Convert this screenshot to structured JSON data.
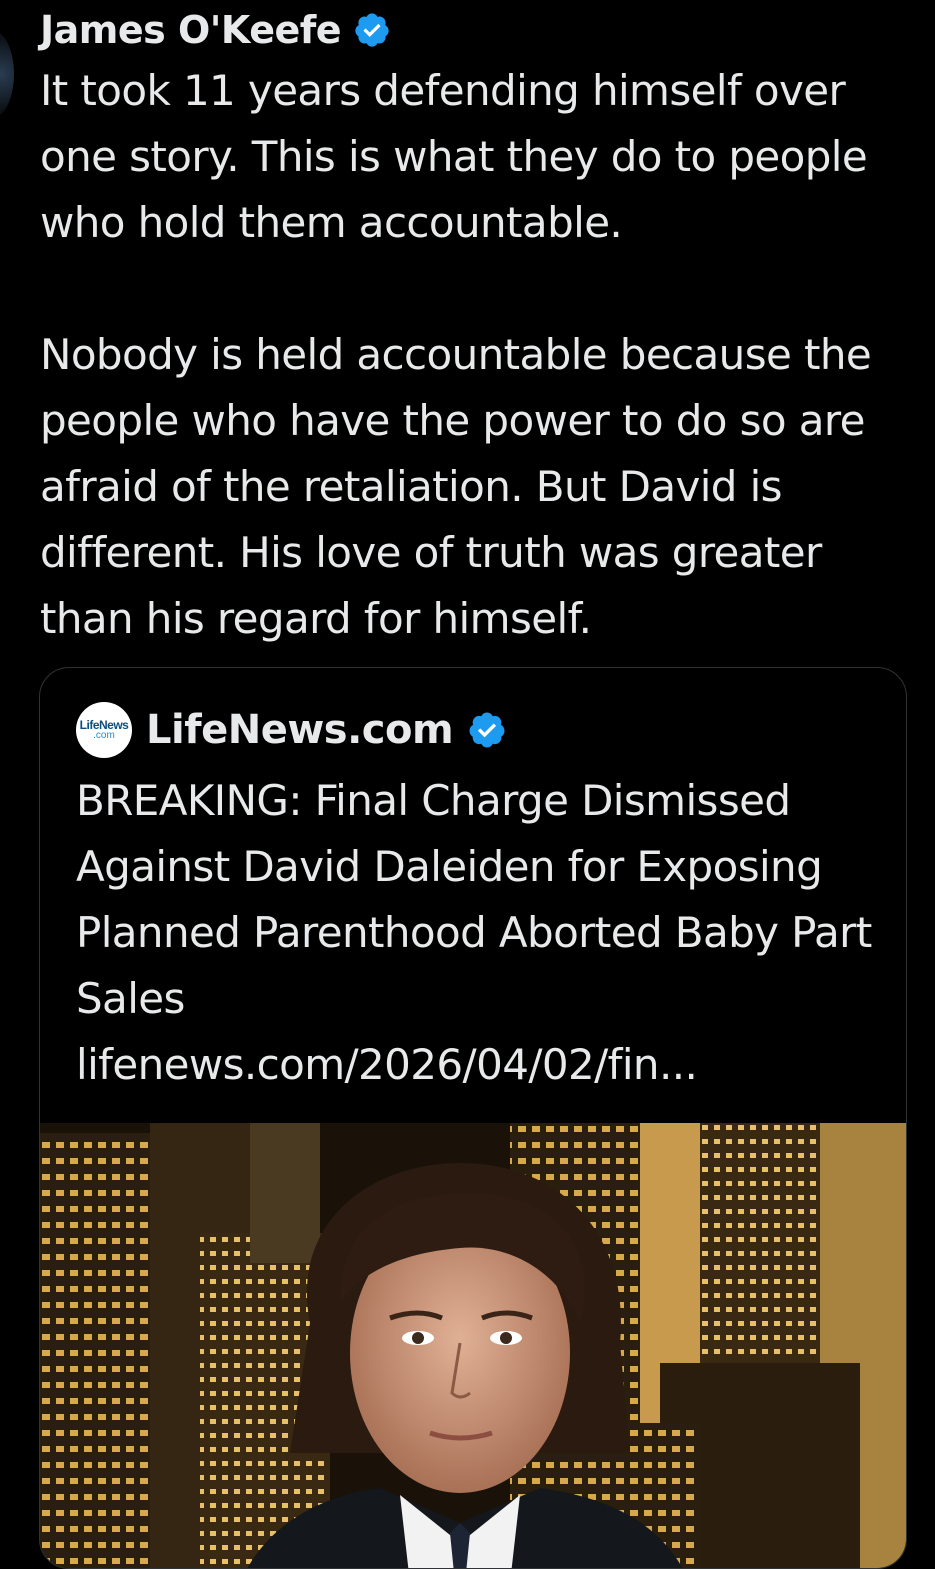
{
  "author": {
    "name": "James O'Keefe",
    "verified_icon": "verified-badge-icon"
  },
  "tweet": {
    "text": "It took 11 years defending himself over one story. This is what they do to people who hold them accountable.\n\nNobody is held accountable because the people who have the power to do so are afraid of the retaliation. But David is different. His love of truth was greater than his regard for himself."
  },
  "quoted": {
    "source_name": "LifeNews.com",
    "logo_text_top": "LifeNews",
    "logo_text_bottom": ".com",
    "headline": "BREAKING: Final Charge Dismissed Against David Daleiden for Exposing Planned Parenthood Aborted Baby Part Sales",
    "link": "lifenews.com/2026/04/02/fin..."
  },
  "colors": {
    "background": "#000000",
    "text": "#e7e9ea",
    "verified": "#1d9bf0",
    "border": "#2f3336"
  }
}
